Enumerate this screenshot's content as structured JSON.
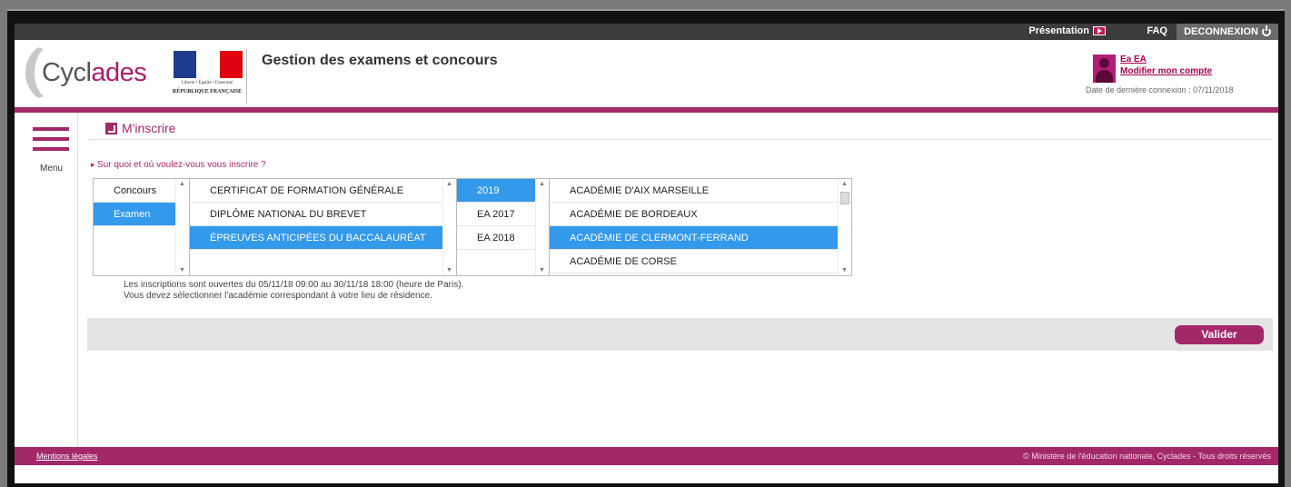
{
  "topbar": {
    "presentation": "Présentation",
    "faq": "FAQ",
    "logout": "DECONNEXION"
  },
  "header": {
    "logo_part1": "Cycl",
    "logo_part2": "ades",
    "marianne_motto": "Liberté • Égalité • Fraternité",
    "marianne_name": "RÉPUBLIQUE FRANÇAISE",
    "site_title": "Gestion des examens et concours"
  },
  "account": {
    "name": "Ea EA",
    "modify": "Modifier mon compte",
    "last_login": "Date de dernière connexion : 07/11/2018"
  },
  "menu": {
    "label": "Menu"
  },
  "section": {
    "title": "M'inscrire",
    "question": "Sur quoi et où voulez-vous vous inscrire ?"
  },
  "lists": {
    "type": [
      "Concours",
      "Examen"
    ],
    "exams": [
      "CERTIFICAT DE FORMATION GÉNÉRALE",
      "DIPLÔME NATIONAL DU BREVET",
      "ÉPREUVES ANTICIPÉES DU BACCALAURÉAT"
    ],
    "sessions": [
      "2019",
      "EA 2017",
      "EA 2018"
    ],
    "academies": [
      "ACADÉMIE D'AIX MARSEILLE",
      "ACADÉMIE DE BORDEAUX",
      "ACADÉMIE DE CLERMONT-FERRAND",
      "ACADÉMIE DE CORSE"
    ]
  },
  "info": {
    "line1": "Les inscriptions sont ouvertes du 05/11/18 09:00 au 30/11/18 18:00 (heure de Paris).",
    "line2": "Vous devez sélectionner l'académie correspondant à votre lieu de résidence."
  },
  "actions": {
    "validate": "Valider"
  },
  "footer": {
    "legal": "Mentions légales",
    "copyright": "© Ministère de l'éducation nationale, Cyclades - Tous droits réservés"
  },
  "colors": {
    "brand": "#a3286a",
    "selection": "#3399ea"
  }
}
